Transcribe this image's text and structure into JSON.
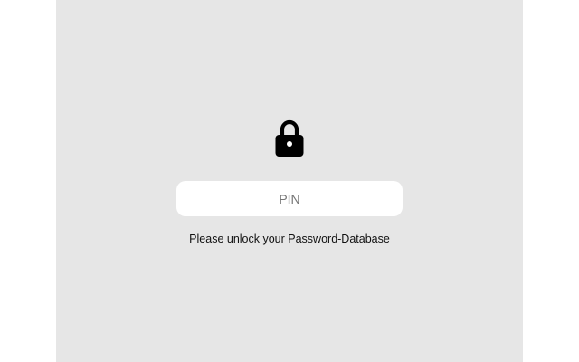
{
  "lock_screen": {
    "icon": "lock-icon",
    "pin_placeholder": "PIN",
    "pin_value": "",
    "message": "Please unlock your Password-Database"
  },
  "colors": {
    "panel_background": "#e6e6e6",
    "outer_background": "#ffffff",
    "input_background": "#ffffff",
    "icon_color": "#000000"
  }
}
